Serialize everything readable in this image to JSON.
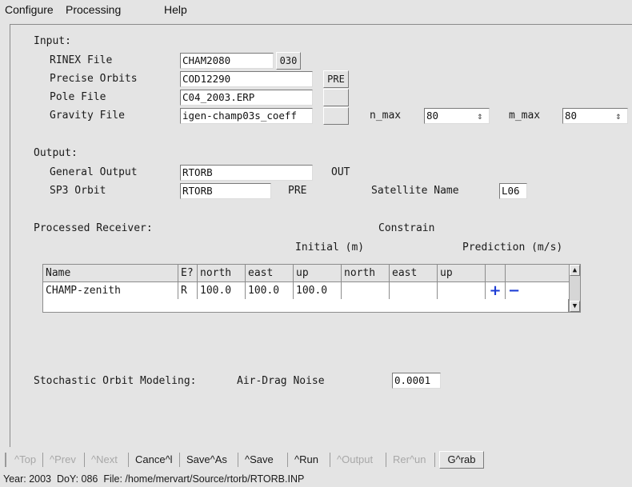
{
  "menu": {
    "configure": "Configure",
    "processing": "Processing",
    "help": "Help"
  },
  "input": {
    "heading": "Input:",
    "rinex_label": "RINEX File",
    "rinex_value": "CHAM2080",
    "rinex_ext": "030",
    "orbits_label": "Precise Orbits",
    "orbits_value": "COD12290",
    "orbits_ext": "PRE",
    "pole_label": "Pole File",
    "pole_value": "C04_2003.ERP",
    "pole_ext": "",
    "gravity_label": "Gravity File",
    "gravity_value": "igen-champ03s_coeff",
    "gravity_ext": "",
    "nmax_label": "n_max",
    "nmax_value": "80",
    "mmax_label": "m_max",
    "mmax_value": "80"
  },
  "output": {
    "heading": "Output:",
    "general_label": "General Output",
    "general_value": "RTORB",
    "general_ext": "OUT",
    "sp3_label": "SP3 Orbit",
    "sp3_value": "RTORB",
    "sp3_ext": "PRE",
    "satname_label": "Satellite Name",
    "satname_value": "L06"
  },
  "receiver": {
    "heading": "Processed Receiver:",
    "constrain": "Constrain",
    "initial": "Initial (m)",
    "prediction": "Prediction (m/s)",
    "columns": [
      "Name",
      "E?",
      "north",
      "east",
      "up",
      "north",
      "east",
      "up",
      "",
      ""
    ],
    "row": [
      "CHAMP-zenith",
      "R",
      "100.0",
      "100.0",
      "100.0",
      "",
      "",
      ""
    ],
    "add": "+",
    "remove": "−"
  },
  "stochastic": {
    "label": "Stochastic Orbit Modeling:",
    "airdrag_label": "Air-Drag Noise",
    "airdrag_value": "0.0001"
  },
  "toolbar": {
    "top": "^Top",
    "prev": "^Prev",
    "next": "^Next",
    "cancel": "Cance^l",
    "saveas": "Save^As",
    "save": "^Save",
    "run": "^Run",
    "output": "^Output",
    "rerun": "Rer^un",
    "grab": "G^rab"
  },
  "status": "Year: 2003  DoY: 086  File: /home/mervart/Source/rtorb/RTORB.INP"
}
